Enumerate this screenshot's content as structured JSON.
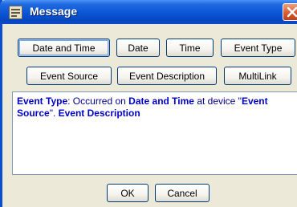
{
  "window": {
    "title": "Message"
  },
  "tokens": {
    "row1": [
      "Date and Time",
      "Date",
      "Time",
      "Event Type"
    ],
    "row2": [
      "Event Source",
      "Event Description",
      "MultiLink"
    ]
  },
  "message": {
    "p1": "Event Type",
    "p2": ": Occurred on ",
    "p3": "Date and Time",
    "p4": " at device \"",
    "p5": "Event Source",
    "p6": "\". ",
    "p7": "Event Description"
  },
  "footer": {
    "ok_label": "OK",
    "cancel_label": "Cancel"
  },
  "colors": {
    "titlebar": "#0a55d6",
    "dialog_bg": "#ece9d8",
    "token_text": "#0000cc"
  }
}
